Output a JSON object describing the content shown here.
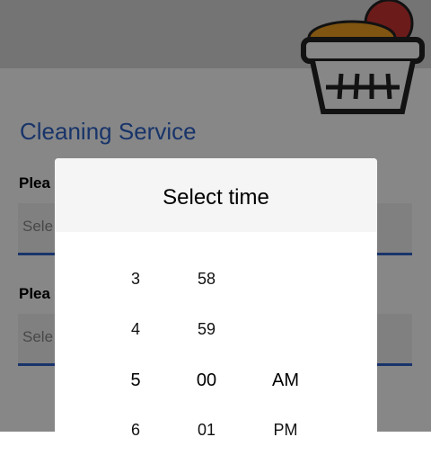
{
  "form": {
    "title": "Cleaning Service",
    "label1": "Plea",
    "field1_placeholder": "Sele",
    "label2": "Plea",
    "field2_placeholder": "Sele"
  },
  "dialog": {
    "title": "Select time",
    "hours": [
      "3",
      "4",
      "5",
      "6"
    ],
    "minutes": [
      "58",
      "59",
      "00",
      "01"
    ],
    "periods": [
      "AM",
      "PM"
    ]
  },
  "colors": {
    "accent": "#2f63c8",
    "overlay": "rgba(0,0,0,0.47)"
  },
  "icons": {
    "header": "laundry-basket-icon"
  }
}
